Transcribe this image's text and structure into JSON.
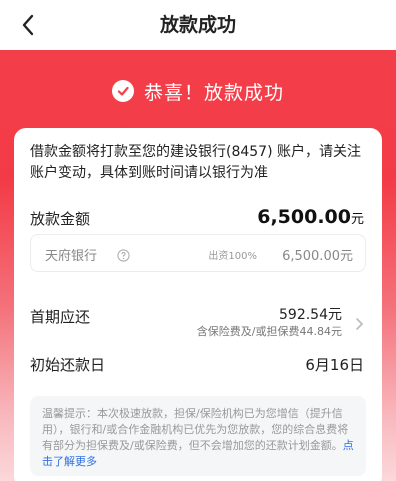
{
  "nav": {
    "title": "放款成功",
    "back_icon": "chevron-left-icon"
  },
  "status": {
    "icon": "check-circle-icon",
    "message": "恭喜！放款成功"
  },
  "card": {
    "notice": "借款金额将打款至您的建设银行(8457) 账户，请关注账户变动，具体到账时间请以银行为准",
    "loan_amount": {
      "label": "放款金额",
      "value": "6,500.00",
      "unit": "元"
    },
    "lender": {
      "name": "天府银行",
      "help_icon": "question-circle-icon",
      "ratio": "出资100%",
      "amount": "6,500.00元"
    },
    "first_payment": {
      "label": "首期应还",
      "value": "592.54元",
      "note": "含保险费及/或担保费44.84元",
      "chevron_icon": "chevron-right-icon"
    },
    "first_repay_date": {
      "label": "初始还款日",
      "value": "6月16日"
    },
    "tips": {
      "text": "温馨提示：本次极速放款，担保/保险机构已为您增信（提升信用），银行和/或合作金融机构已优先为您放款，您的综合息费将有部分为担保费及/或保险费，但不会增加您的还款计划金额。",
      "link": "点击了解更多"
    }
  },
  "colors": {
    "brand_red": "#f33f4a",
    "link_blue": "#2f6fe4"
  }
}
